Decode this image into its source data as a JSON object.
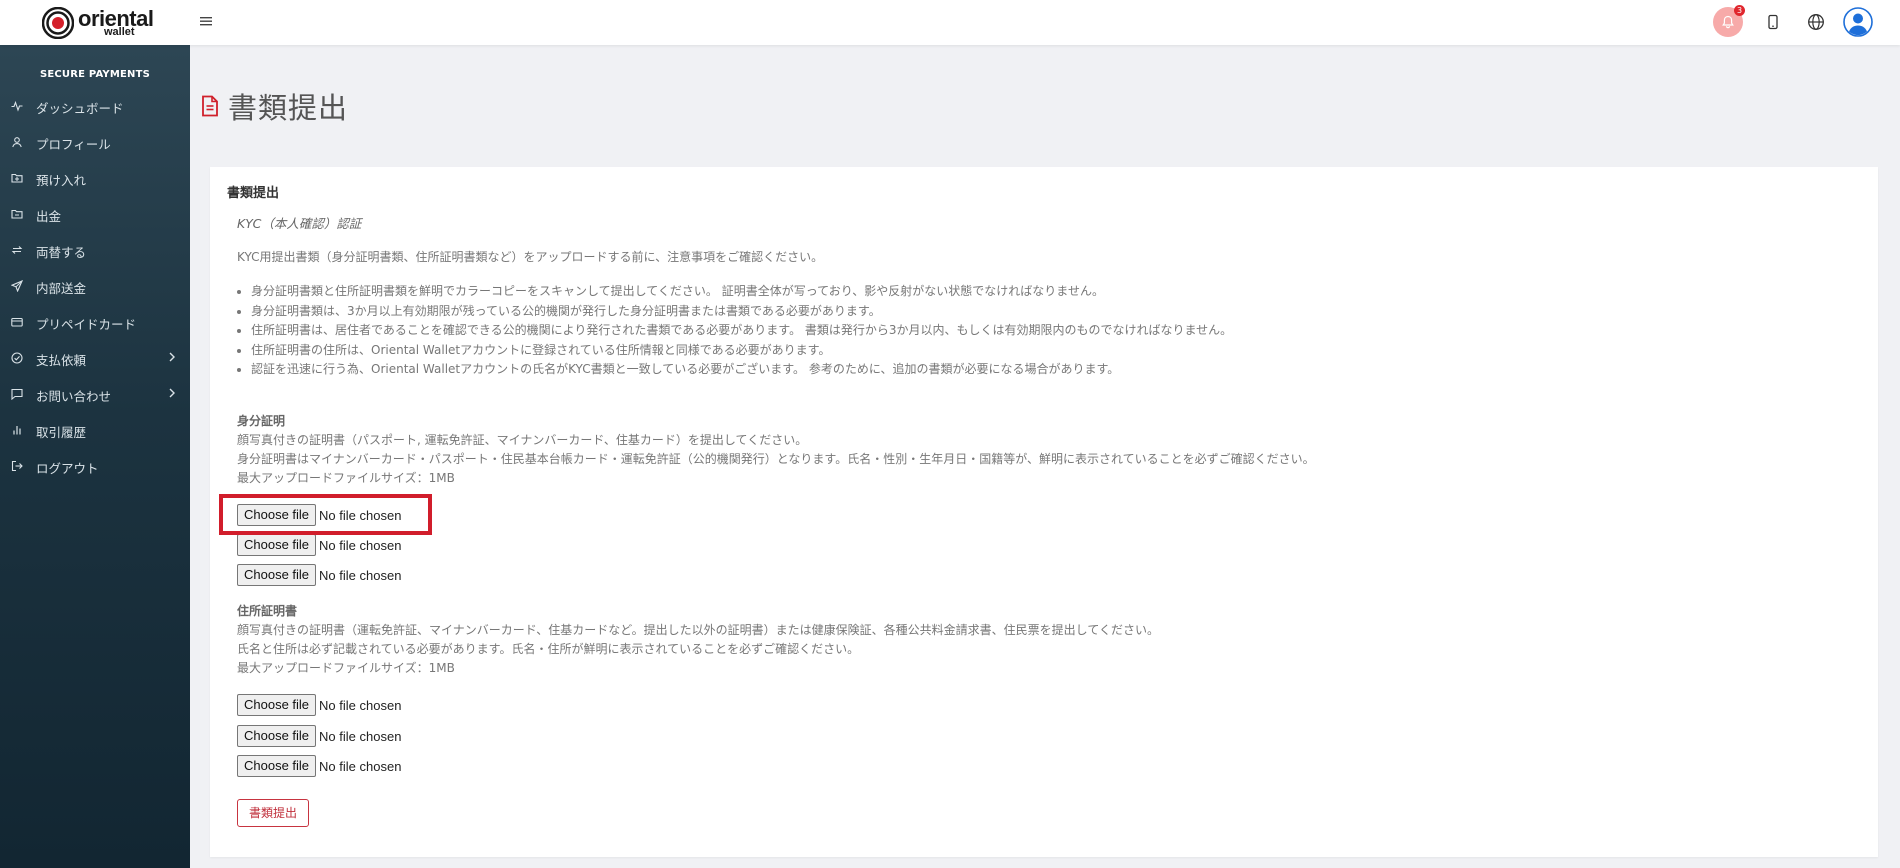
{
  "brand": {
    "name_line1": "oriental",
    "name_line2": "wallet"
  },
  "header": {
    "notification_count": "3"
  },
  "sidebar": {
    "heading": "SECURE PAYMENTS",
    "items": [
      {
        "label": "ダッシュボード",
        "icon": "activity-icon"
      },
      {
        "label": "プロフィール",
        "icon": "user-icon"
      },
      {
        "label": "預け入れ",
        "icon": "folder-in-icon"
      },
      {
        "label": "出金",
        "icon": "folder-out-icon"
      },
      {
        "label": "両替する",
        "icon": "exchange-icon"
      },
      {
        "label": "内部送金",
        "icon": "send-icon"
      },
      {
        "label": "プリペイドカード",
        "icon": "card-icon"
      },
      {
        "label": "支払依頼",
        "icon": "check-circle-icon",
        "has_submenu": true
      },
      {
        "label": "お問い合わせ",
        "icon": "message-icon",
        "has_submenu": true
      },
      {
        "label": "取引履歴",
        "icon": "bar-chart-icon"
      },
      {
        "label": "ログアウト",
        "icon": "logout-icon"
      }
    ]
  },
  "page": {
    "title": "書類提出"
  },
  "card": {
    "title": "書類提出",
    "kyc_title": "KYC（本人確認）認証",
    "intro": "KYC用提出書類（身分証明書類、住所証明書類など）をアップロードする前に、注意事項をご確認ください。",
    "notes": [
      "身分証明書類と住所証明書類を鮮明でカラーコピーをスキャンして提出してください。 証明書全体が写っており、影や反射がない状態でなければなりません。",
      "身分証明書類は、3か月以上有効期限が残っている公的機関が発行した身分証明書または書類である必要があります。",
      "住所証明書は、居住者であることを確認できる公的機関により発行された書類である必要があります。 書類は発行から3か月以内、もしくは有効期限内のものでなければなりません。",
      "住所証明書の住所は、Oriental Walletアカウントに登録されている住所情報と同様である必要があります。",
      "認証を迅速に行う為、Oriental Walletアカウントの氏名がKYC書類と一致している必要がございます。 参考のために、追加の書類が必要になる場合があります。"
    ],
    "identity": {
      "title": "身分証明",
      "line1": "顔写真付きの証明書（パスポート, 運転免許証、マイナンバーカード、住基カード）を提出してください。",
      "line2": "身分証明書はマイナンバーカード・パスポート・住民基本台帳カード・運転免許証（公的機関発行）となります。氏名・性別・生年月日・国籍等が、鮮明に表示されていることを必ずご確認ください。",
      "max_size": "最大アップロードファイルサイズ：1MB"
    },
    "address": {
      "title": "住所証明書",
      "line1": "顔写真付きの証明書（運転免許証、マイナンバーカード、住基カードなど。提出した以外の証明書）または健康保険証、各種公共料金請求書、住民票を提出してください。",
      "line2": "氏名と住所は必ず記載されている必要があります。氏名・住所が鮮明に表示されていることを必ずご確認ください。",
      "max_size": "最大アップロードファイルサイズ：1MB"
    },
    "file_input": {
      "button_label": "Choose file",
      "status": "No file chosen"
    },
    "submit_label": "書類提出"
  },
  "colors": {
    "sidebar_top": "#2d4654",
    "sidebar_bottom": "#122632",
    "accent_red": "#c0303c",
    "highlight_red": "#d11d2b"
  }
}
